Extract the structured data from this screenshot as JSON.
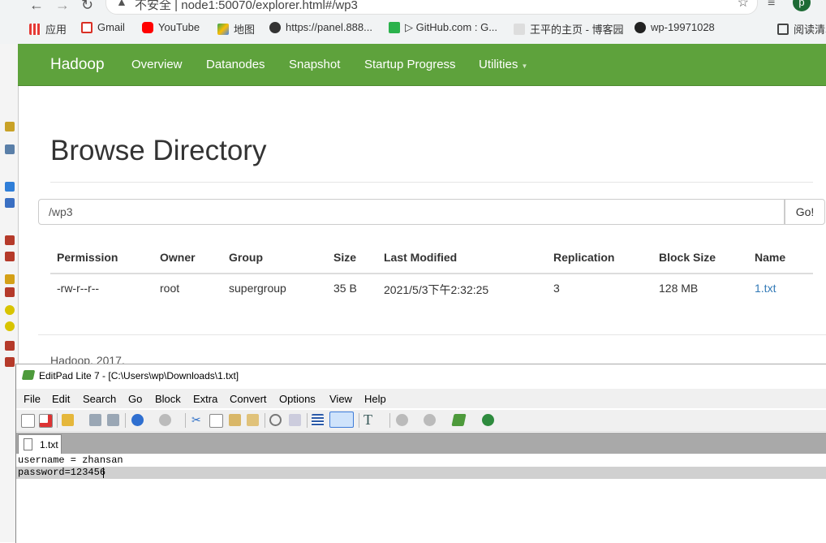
{
  "browser": {
    "url": "不安全 | node1:50070/explorer.html#/wp3",
    "profile_initial": "p",
    "bookmarks": [
      "应用",
      "Gmail",
      "YouTube",
      "地图",
      "https://panel.888...",
      "▷ GitHub.com : G...",
      "王平的主页 - 博客园",
      "wp-19971028",
      "阅读清单"
    ]
  },
  "hadoop": {
    "brand": "Hadoop",
    "nav": [
      "Overview",
      "Datanodes",
      "Snapshot",
      "Startup Progress",
      "Utilities"
    ],
    "page_title": "Browse Directory",
    "path_value": "/wp3",
    "go_label": "Go!",
    "columns": [
      "Permission",
      "Owner",
      "Group",
      "Size",
      "Last Modified",
      "Replication",
      "Block Size",
      "Name"
    ],
    "rows": [
      [
        "-rw-r--r--",
        "root",
        "supergroup",
        "35 B",
        "2021/5/3下午2:32:25",
        "3",
        "128 MB",
        "1.txt"
      ]
    ],
    "footer": "Hadoop, 2017."
  },
  "editpad": {
    "title": "EditPad Lite 7 - [C:\\Users\\wp\\Downloads\\1.txt]",
    "menus": [
      "File",
      "Edit",
      "Search",
      "Go",
      "Block",
      "Extra",
      "Convert",
      "Options",
      "View",
      "Help"
    ],
    "tab": "1.txt",
    "lines": [
      "username = zhansan",
      "password=123456"
    ]
  },
  "colors": {
    "navbar": "#5ea23c",
    "link": "#337ab7"
  }
}
